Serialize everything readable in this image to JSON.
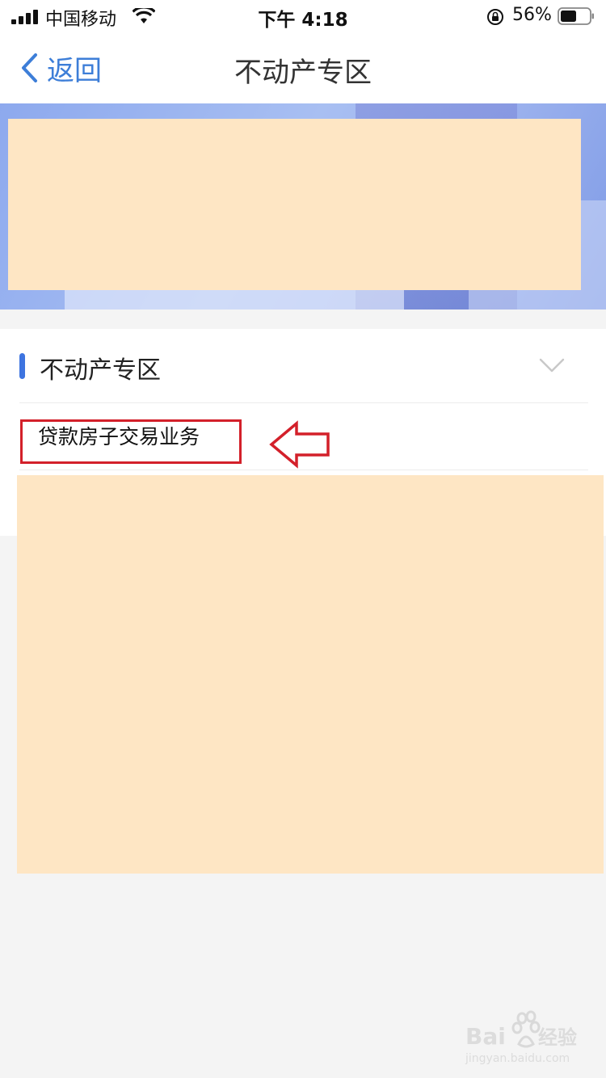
{
  "status_bar": {
    "carrier": "中国移动",
    "time": "下午 4:18",
    "battery_percent": "56%",
    "battery_level": 0.56
  },
  "nav": {
    "back_label": "返回",
    "title": "不动产专区"
  },
  "section": {
    "title": "不动产专区",
    "expanded_indicator": "chevron-down-icon",
    "items": [
      {
        "label": "贷款房子交易业务"
      }
    ]
  },
  "colors": {
    "accent_blue": "#3e74e0",
    "link_blue": "#3d7ed8",
    "annotation_red": "#d3202a",
    "redaction": "#fee6c4"
  }
}
